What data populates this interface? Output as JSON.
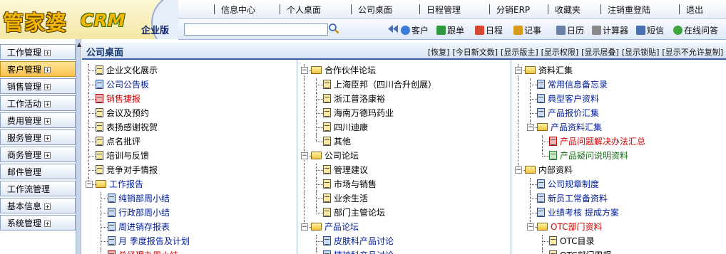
{
  "logo": {
    "brand": "管家婆",
    "crm": "CRM",
    "edition": "企业版"
  },
  "topnav": [
    "信息中心",
    "个人桌面",
    "公司桌面",
    "日程管理",
    "分销ERP",
    "收藏夹",
    "注销重登陆",
    "退出"
  ],
  "search": {
    "value": "",
    "placeholder": ""
  },
  "toolbar": [
    {
      "label": "客户",
      "icon": "customer-icon"
    },
    {
      "label": "跟单",
      "icon": "follow-up-icon"
    },
    {
      "label": "日程",
      "icon": "calendar-icon"
    },
    {
      "label": "记事",
      "icon": "note-icon"
    },
    {
      "label": "日历",
      "icon": "date-icon"
    },
    {
      "label": "计算器",
      "icon": "calculator-icon"
    },
    {
      "label": "短信",
      "icon": "sms-icon"
    },
    {
      "label": "在线问答",
      "icon": "help-icon"
    }
  ],
  "menu": [
    {
      "label": "工作管理",
      "expandable": true,
      "active": false
    },
    {
      "label": "客户管理",
      "expandable": true,
      "active": true
    },
    {
      "label": "销售管理",
      "expandable": true,
      "active": false
    },
    {
      "label": "工作活动",
      "expandable": true,
      "active": false
    },
    {
      "label": "费用管理",
      "expandable": true,
      "active": false
    },
    {
      "label": "服务管理",
      "expandable": true,
      "active": false
    },
    {
      "label": "商务管理",
      "expandable": true,
      "active": false
    },
    {
      "label": "邮件管理",
      "expandable": false,
      "active": false
    },
    {
      "label": "工作流管理",
      "expandable": false,
      "active": false
    },
    {
      "label": "基本信息",
      "expandable": true,
      "active": false
    },
    {
      "label": "系统管理",
      "expandable": true,
      "active": false
    }
  ],
  "main": {
    "title": "公司桌面",
    "actions": [
      "[恢复]",
      "[今日新文数]",
      "[显示版主]",
      "[显示权限]",
      "[显示层叠]",
      "[显示锁贴]",
      "[显示不允许复制]"
    ]
  },
  "colors": {
    "accent": "#3a5fa8",
    "active_menu": "#fbc24a",
    "link_blue": "#001e9c",
    "link_red": "#d40000",
    "link_green": "#126f12"
  },
  "tree": [
    [
      {
        "level": 0,
        "type": "doc",
        "icon": "yellow",
        "color": "black",
        "label": "企业文化展示"
      },
      {
        "level": 0,
        "type": "doc",
        "icon": "blue",
        "color": "blue",
        "label": "公司公告板"
      },
      {
        "level": 0,
        "type": "doc",
        "icon": "red",
        "color": "red",
        "label": "销售捷报"
      },
      {
        "level": 0,
        "type": "doc",
        "icon": "yellow",
        "color": "black",
        "label": "会议及预约"
      },
      {
        "level": 0,
        "type": "doc",
        "icon": "yellow",
        "color": "black",
        "label": "表扬感谢祝贺"
      },
      {
        "level": 0,
        "type": "doc",
        "icon": "yellow",
        "color": "black",
        "label": "点名批评"
      },
      {
        "level": 0,
        "type": "doc",
        "icon": "yellow",
        "color": "black",
        "label": "培训与反馈"
      },
      {
        "level": 0,
        "type": "doc",
        "icon": "yellow",
        "color": "black",
        "label": "竞争对手情报"
      },
      {
        "level": 0,
        "type": "folder",
        "color": "blue",
        "label": "工作报告"
      },
      {
        "level": 1,
        "type": "doc",
        "icon": "blue",
        "color": "blue",
        "label": "纯销部周小结"
      },
      {
        "level": 1,
        "type": "doc",
        "icon": "blue",
        "color": "blue",
        "label": "行政部周小结"
      },
      {
        "level": 1,
        "type": "doc",
        "icon": "blue",
        "color": "blue",
        "label": "周进销存报表"
      },
      {
        "level": 1,
        "type": "doc",
        "icon": "blue",
        "color": "blue",
        "label": "月  季度报告及计划"
      },
      {
        "level": 1,
        "type": "doc",
        "icon": "red",
        "color": "red",
        "label": "总经理办周小结"
      }
    ],
    [
      {
        "level": 0,
        "type": "folder",
        "color": "black",
        "label": "合作伙伴论坛"
      },
      {
        "level": 1,
        "type": "doc",
        "icon": "yellow",
        "color": "black",
        "label": "上海臣邦（四川合升创展）"
      },
      {
        "level": 1,
        "type": "doc",
        "icon": "yellow",
        "color": "black",
        "label": "浙江普洛康裕"
      },
      {
        "level": 1,
        "type": "doc",
        "icon": "yellow",
        "color": "black",
        "label": "海南万德玛药业"
      },
      {
        "level": 1,
        "type": "doc",
        "icon": "yellow",
        "color": "black",
        "label": "四川迪康"
      },
      {
        "level": 1,
        "type": "doc",
        "icon": "yellow",
        "color": "black",
        "label": "其他"
      },
      {
        "level": 0,
        "type": "folder",
        "color": "black",
        "label": "公司论坛"
      },
      {
        "level": 1,
        "type": "doc",
        "icon": "yellow",
        "color": "black",
        "label": "管理建议"
      },
      {
        "level": 1,
        "type": "doc",
        "icon": "yellow",
        "color": "black",
        "label": "市场与销售"
      },
      {
        "level": 1,
        "type": "doc",
        "icon": "yellow",
        "color": "black",
        "label": "业余生活"
      },
      {
        "level": 1,
        "type": "doc",
        "icon": "yellow",
        "color": "black",
        "label": "部门主管论坛"
      },
      {
        "level": 0,
        "type": "folder",
        "color": "blue",
        "label": "产品论坛"
      },
      {
        "level": 1,
        "type": "doc",
        "icon": "blue",
        "color": "blue",
        "label": "皮肤科产品讨论"
      },
      {
        "level": 1,
        "type": "doc",
        "icon": "blue",
        "color": "blue",
        "label": "精神科产品讨论"
      }
    ],
    [
      {
        "level": 0,
        "type": "folder",
        "color": "black",
        "label": "资料汇集"
      },
      {
        "level": 1,
        "type": "doc",
        "icon": "blue",
        "color": "blue",
        "label": "常用信息备忘录"
      },
      {
        "level": 1,
        "type": "doc",
        "icon": "blue",
        "color": "blue",
        "label": "典型客户资料"
      },
      {
        "level": 1,
        "type": "doc",
        "icon": "blue",
        "color": "blue",
        "label": "产品报价汇集"
      },
      {
        "level": 1,
        "type": "folder",
        "color": "blue",
        "label": "产品资料汇集"
      },
      {
        "level": 2,
        "type": "doc",
        "icon": "red",
        "color": "red",
        "label": "产品问题解决办法汇总"
      },
      {
        "level": 2,
        "type": "doc",
        "icon": "green",
        "color": "green",
        "label": "产品疑问说明资料"
      },
      {
        "level": 0,
        "type": "folder",
        "color": "black",
        "label": "内部资料"
      },
      {
        "level": 1,
        "type": "doc",
        "icon": "blue",
        "color": "blue",
        "label": "公司规章制度"
      },
      {
        "level": 1,
        "type": "doc",
        "icon": "blue",
        "color": "blue",
        "label": "新员工常备资料"
      },
      {
        "level": 1,
        "type": "doc",
        "icon": "blue",
        "color": "blue",
        "label": "业绩考核  提成方案"
      },
      {
        "level": 1,
        "type": "folder",
        "color": "red",
        "label": "OTC部门资料"
      },
      {
        "level": 2,
        "type": "doc",
        "icon": "yellow",
        "color": "black",
        "label": "OTC目录"
      },
      {
        "level": 2,
        "type": "doc",
        "icon": "yellow",
        "color": "black",
        "label": "OTC部门周报"
      }
    ]
  ]
}
